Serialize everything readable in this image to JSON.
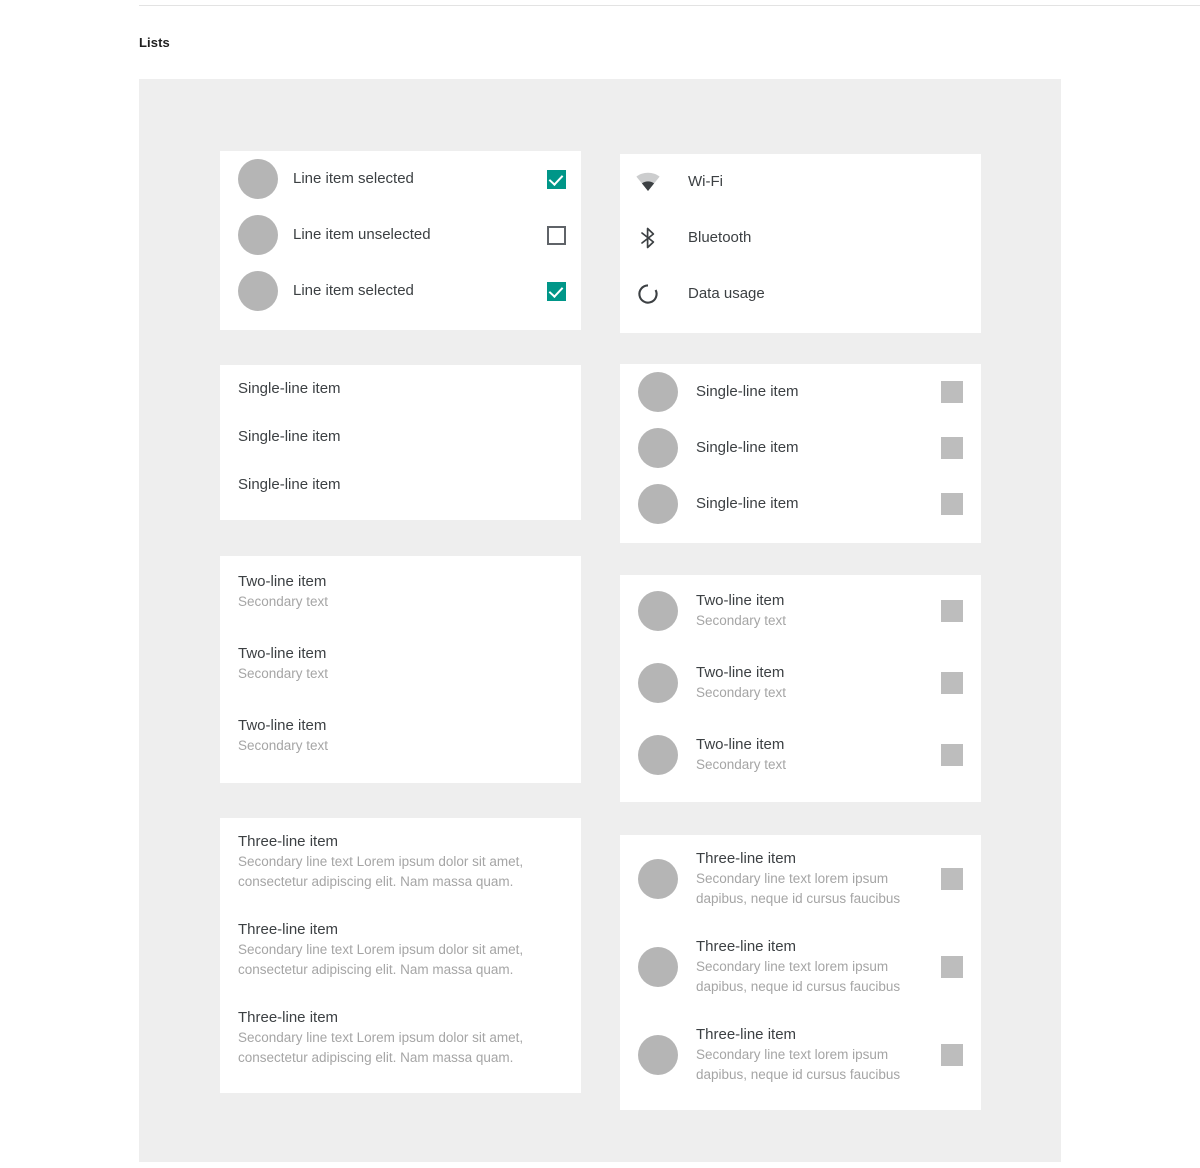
{
  "page": {
    "section_title": "Lists",
    "colors": {
      "canvas": "#eeeeee",
      "card": "#ffffff",
      "accent_checkbox": "#009688",
      "avatar": "#b5b5b5",
      "square_icon": "#bdbdbd",
      "primary_text": "#3c4043",
      "secondary_text": "#a5a5a5"
    }
  },
  "cards": {
    "checkbox_list": {
      "name": "checkbox-list-card",
      "rows": [
        {
          "avatar": "avatar",
          "label": "Line item selected",
          "checkbox": "checked"
        },
        {
          "avatar": "avatar",
          "label": "Line item unselected",
          "checkbox": "unchecked"
        },
        {
          "avatar": "avatar",
          "label": "Line item selected",
          "checkbox": "checked"
        }
      ]
    },
    "icon_list": {
      "name": "settings-icon-list-card",
      "rows": [
        {
          "icon": "wifi-icon",
          "label": "Wi-Fi"
        },
        {
          "icon": "bluetooth-icon",
          "label": "Bluetooth"
        },
        {
          "icon": "data-usage-icon",
          "label": "Data usage"
        }
      ]
    },
    "single_line_plain": {
      "name": "single-line-plain-card",
      "rows": [
        {
          "primary": "Single-line item"
        },
        {
          "primary": "Single-line item"
        },
        {
          "primary": "Single-line item"
        }
      ]
    },
    "single_line_avatar": {
      "name": "single-line-avatar-card",
      "rows": [
        {
          "primary": "Single-line item",
          "trailing": "square-icon"
        },
        {
          "primary": "Single-line item",
          "trailing": "square-icon"
        },
        {
          "primary": "Single-line item",
          "trailing": "square-icon"
        }
      ]
    },
    "two_line_plain": {
      "name": "two-line-plain-card",
      "rows": [
        {
          "primary": "Two-line item",
          "secondary": "Secondary text"
        },
        {
          "primary": "Two-line item",
          "secondary": "Secondary text"
        },
        {
          "primary": "Two-line item",
          "secondary": "Secondary text"
        }
      ]
    },
    "two_line_avatar": {
      "name": "two-line-avatar-card",
      "rows": [
        {
          "primary": "Two-line item",
          "secondary": "Secondary text",
          "trailing": "square-icon"
        },
        {
          "primary": "Two-line item",
          "secondary": "Secondary text",
          "trailing": "square-icon"
        },
        {
          "primary": "Two-line item",
          "secondary": "Secondary text",
          "trailing": "square-icon"
        }
      ]
    },
    "three_line_plain": {
      "name": "three-line-plain-card",
      "rows": [
        {
          "primary": "Three-line item",
          "secondary": "Secondary line text Lorem ipsum dolor sit amet, consectetur adipiscing elit. Nam massa quam."
        },
        {
          "primary": "Three-line item",
          "secondary": "Secondary line text Lorem ipsum dolor sit amet, consectetur adipiscing elit. Nam massa quam."
        },
        {
          "primary": "Three-line item",
          "secondary": "Secondary line text Lorem ipsum dolor sit amet, consectetur adipiscing elit. Nam massa quam."
        }
      ]
    },
    "three_line_avatar": {
      "name": "three-line-avatar-card",
      "rows": [
        {
          "primary": "Three-line item",
          "secondary": "Secondary line text lorem ipsum dapibus, neque id cursus faucibus",
          "trailing": "square-icon"
        },
        {
          "primary": "Three-line item",
          "secondary": "Secondary line text lorem ipsum dapibus, neque id cursus faucibus",
          "trailing": "square-icon"
        },
        {
          "primary": "Three-line item",
          "secondary": "Secondary line text lorem ipsum dapibus, neque id cursus faucibus",
          "trailing": "square-icon"
        }
      ]
    }
  }
}
